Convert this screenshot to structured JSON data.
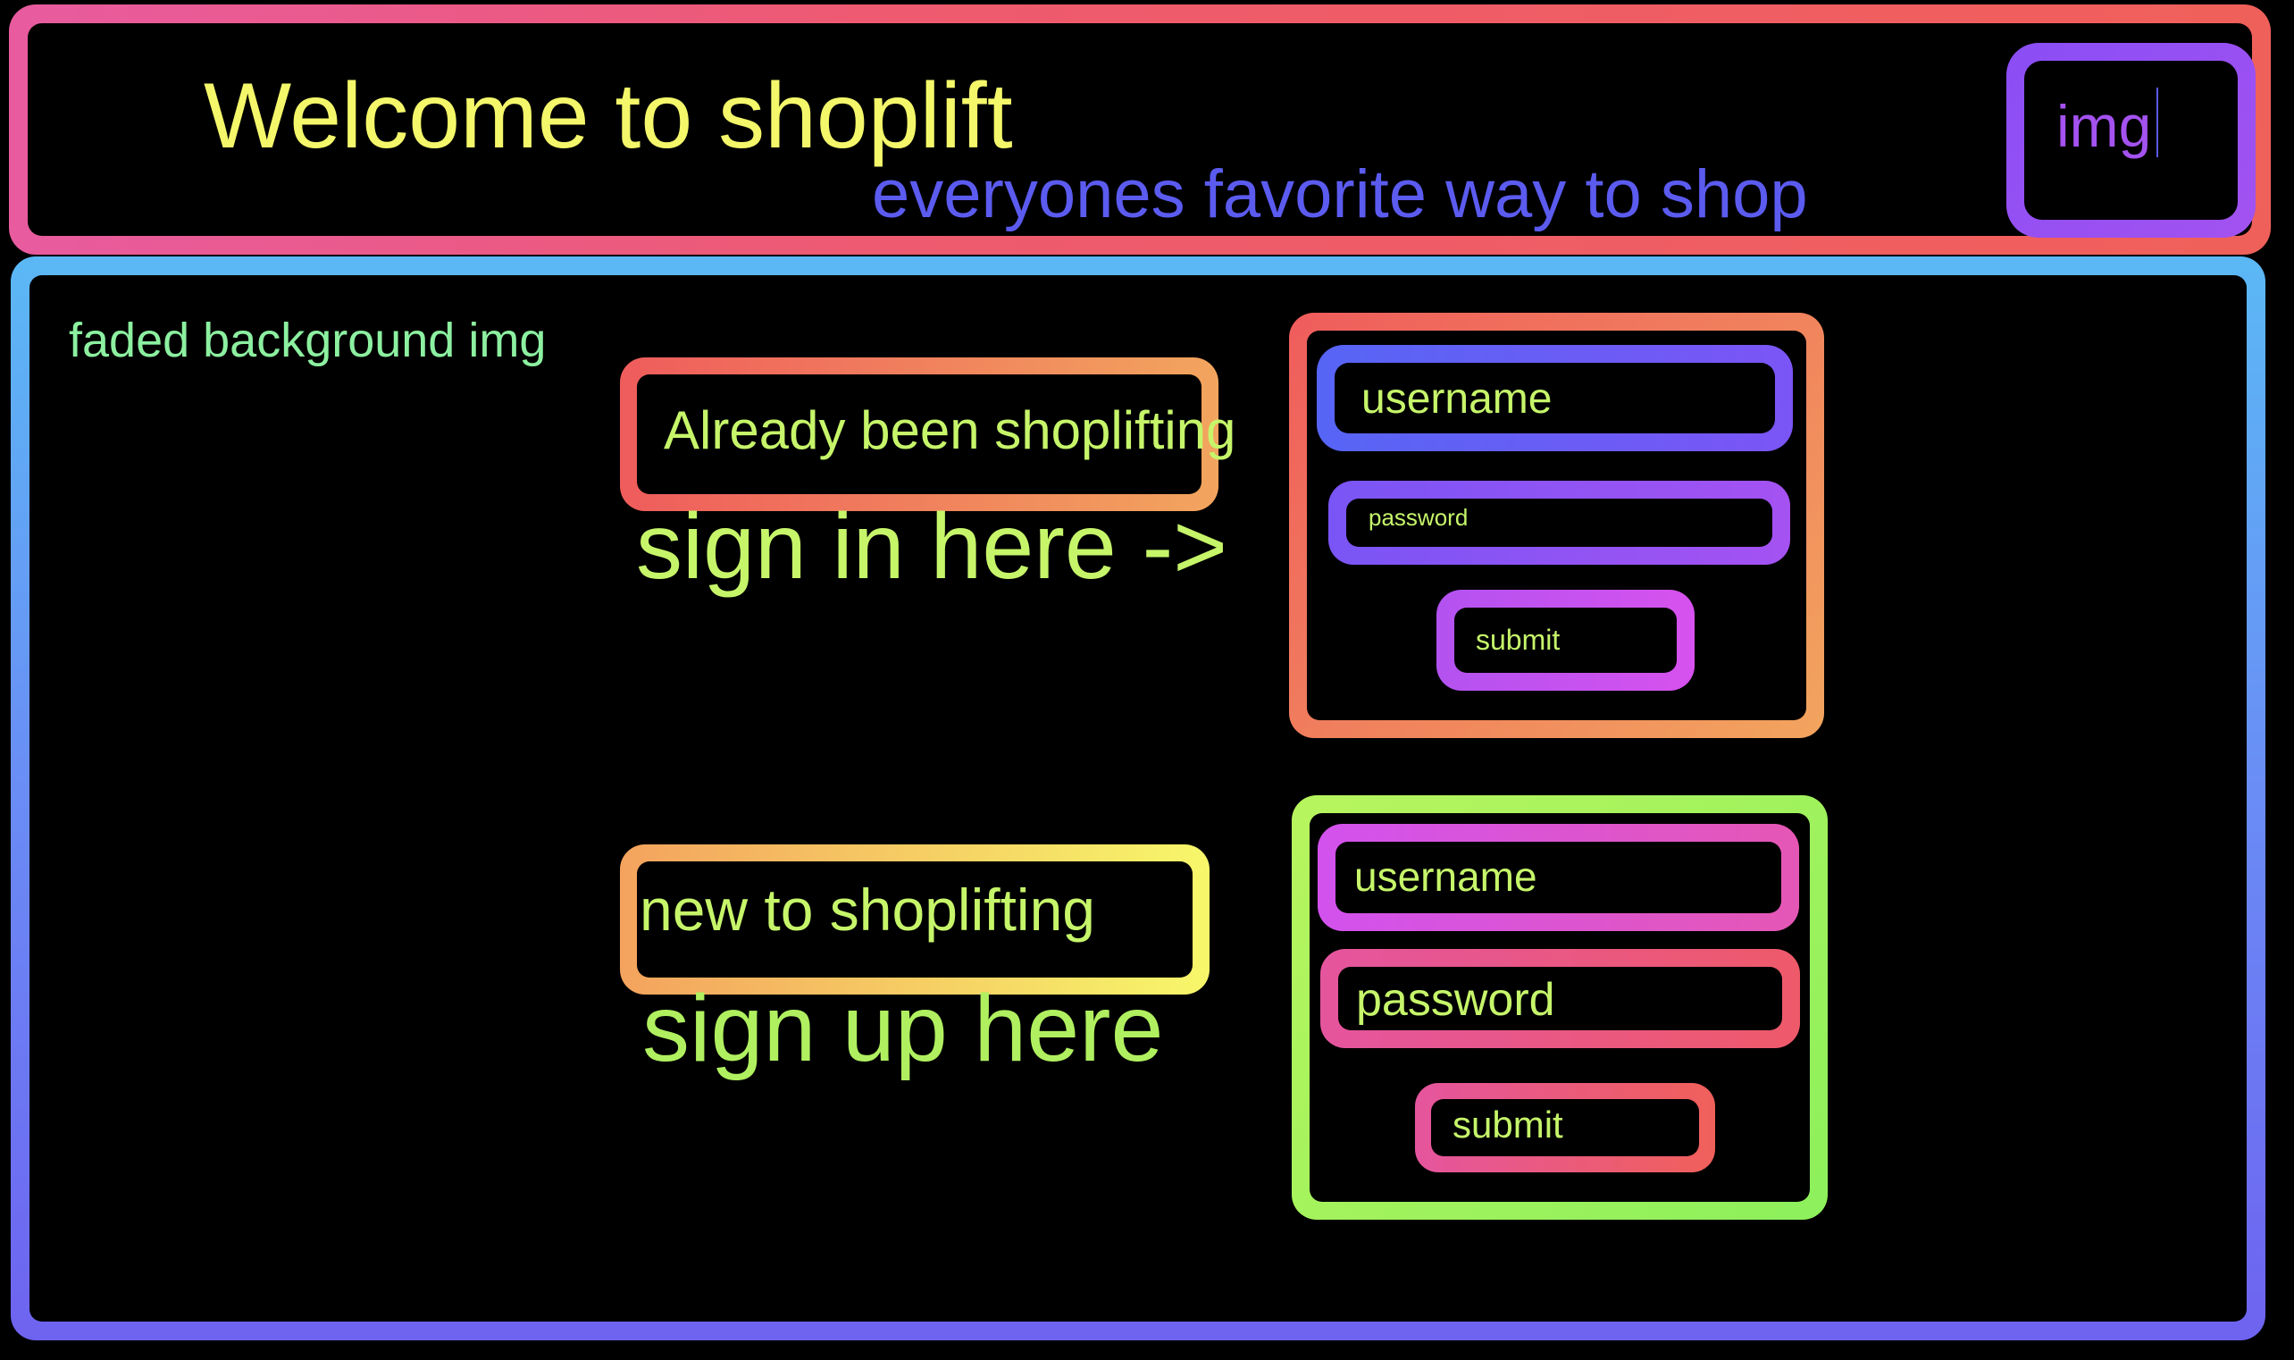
{
  "header": {
    "title": "Welcome to shoplift",
    "tagline": "everyones favorite way to shop",
    "logo_placeholder": "img"
  },
  "main": {
    "background_note": "faded background img",
    "sign_in": {
      "prompt": "Already been shoplifting",
      "call_to_action": "sign in here ->",
      "username_label": "username",
      "password_label": "password",
      "submit_label": "submit"
    },
    "sign_up": {
      "prompt": "new to shoplifting",
      "call_to_action": "sign up here",
      "username_label": "username",
      "password_label": "password",
      "submit_label": "submit"
    }
  },
  "colors": {
    "background": "#000000",
    "title_text": "#f4f76a",
    "tagline_text": "#5b5bf0",
    "logo_text": "#a452f0",
    "body_text": "#c6f56a",
    "note_text": "#8cf0a0"
  }
}
